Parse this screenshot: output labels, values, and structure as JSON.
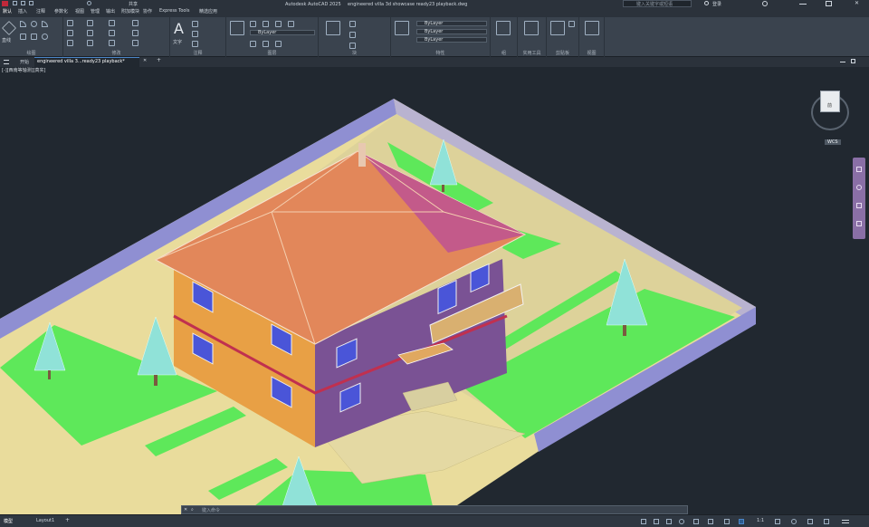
{
  "titlebar": {
    "app_title": "Autodesk AutoCAD 2025",
    "file_title": "engineered villa 3d showcase ready23 playback.dwg",
    "search_placeholder": "键入关键字或短语",
    "user": "登录"
  },
  "ribbon": {
    "tabs": [
      "默认",
      "插入",
      "注释",
      "参数化",
      "视图",
      "管理",
      "输出",
      "附加模块",
      "协作",
      "Express Tools",
      "精选应用"
    ],
    "active_tab_index": 0,
    "groups": [
      "绘图",
      "修改",
      "注释",
      "图层",
      "块",
      "特性",
      "组",
      "实用工具",
      "剪贴板",
      "视图"
    ],
    "layer_dropdown": "ByLayer",
    "property_dropdowns": [
      "ByLayer",
      "ByLayer",
      "ByLayer"
    ],
    "text_button": "文字",
    "line_button": "直线"
  },
  "file_tabs": {
    "start": "开始",
    "doc": "engineered villa 3...ready23 playback*",
    "add": "+"
  },
  "viewport": {
    "view_label": "[-][西南等轴测][真实]",
    "viewcube_face": "前",
    "wcs_label": "WCS"
  },
  "statusbar": {
    "model_tab": "模型",
    "layout_tab": "Layout1",
    "add_layout": "+",
    "command_placeholder": "键入命令",
    "scale": "1:1"
  },
  "colors": {
    "grass": "#5ee85a",
    "roof": "#e2875a",
    "wall_orange": "#e8a045",
    "wall_purple": "#7a5294",
    "terrace": "#e9dc9c",
    "purple_wall": "#8f8fd2",
    "tree": "#90e2d8",
    "window": "#4a55d8"
  }
}
